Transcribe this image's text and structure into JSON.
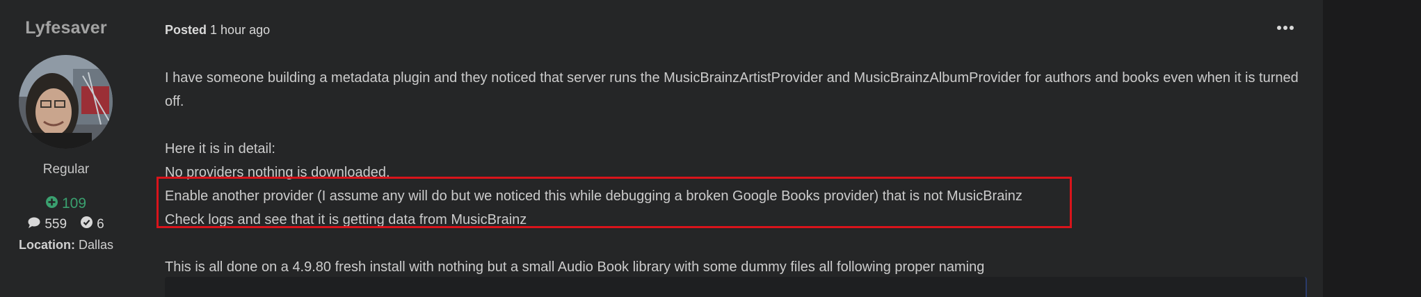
{
  "author": {
    "name": "Lyfesaver",
    "rank": "Regular",
    "reputation": "109",
    "posts": "559",
    "solutions": "6",
    "location_label": "Location:",
    "location_value": "Dallas"
  },
  "post": {
    "posted_label": "Posted",
    "time_ago": "1 hour ago",
    "paragraph1": "I have someone building a metadata plugin and they noticed that server runs the MusicBrainzArtistProvider and MusicBrainzAlbumProvider for authors and books even when it is turned off.",
    "line_detail": "Here it is in detail:",
    "line_step1": "No providers nothing is downloaded.",
    "line_step2": "Enable another provider (I assume any will do but we noticed this while debugging a broken Google Books provider) that is not MusicBrainz",
    "line_step3": "Check logs and see that it is getting data from MusicBrainz",
    "paragraph_last": "This is all done on a 4.9.80 fresh install with nothing but a small Audio Book library with some dummy files all following proper naming"
  },
  "colors": {
    "highlight_border": "#d9141b",
    "reputation_green": "#3aa06f"
  },
  "icons": {
    "more": "more-options-icon",
    "reputation": "plus-circle-icon",
    "posts": "comment-icon",
    "solutions": "check-circle-icon"
  }
}
